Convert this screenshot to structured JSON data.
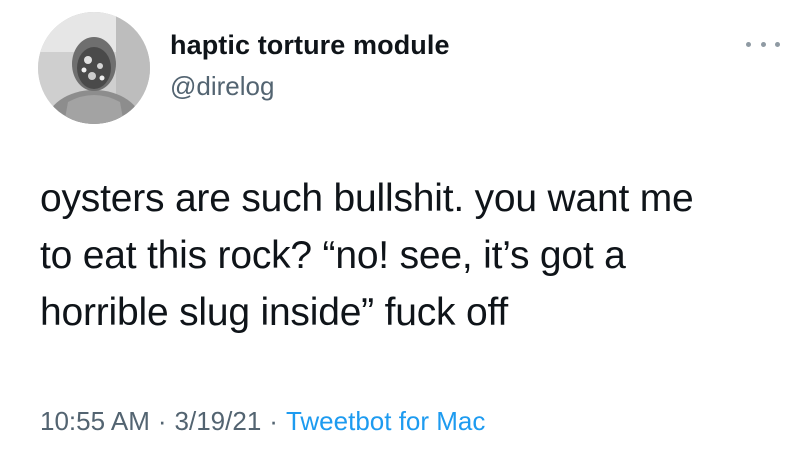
{
  "author": {
    "display_name": "haptic torture module",
    "handle": "@direlog"
  },
  "tweet": {
    "lines": [
      "oysters are such bullshit. you want me",
      "to eat this rock? “no! see, it’s got a",
      "horrible slug inside” fuck off"
    ]
  },
  "meta": {
    "time": "10:55 AM",
    "separator": "·",
    "date": "3/19/21",
    "source": "Tweetbot for Mac"
  },
  "icons": {
    "more": "more-options-icon",
    "avatar": "profile-photo"
  },
  "colors": {
    "text": "#0f1419",
    "secondary": "#536471",
    "link": "#1d9bf0"
  }
}
